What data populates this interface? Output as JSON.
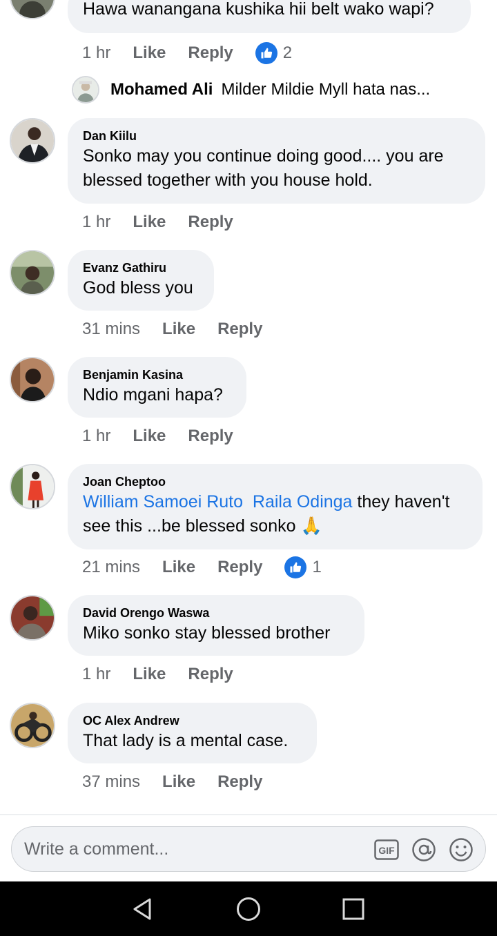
{
  "top_comment": {
    "text": "Hawa wanangana kushika hii belt wako wapi?",
    "time": "1 hr",
    "like_label": "Like",
    "reply_label": "Reply",
    "reaction_count": "2",
    "reply_preview": {
      "name": "Mohamed Ali",
      "snippet": "Milder Mildie Myll hata nas..."
    }
  },
  "comments": [
    {
      "author": "Dan Kiilu",
      "lines": [
        "Sonko may you  continue doing good.... you are",
        "blessed together with you house hold."
      ],
      "time": "1 hr",
      "like_label": "Like",
      "reply_label": "Reply"
    },
    {
      "author": "Evanz Gathiru",
      "lines": [
        "God bless you"
      ],
      "time": "31 mins",
      "like_label": "Like",
      "reply_label": "Reply"
    },
    {
      "author": "Benjamin Kasina",
      "lines": [
        "Ndio mgani hapa?"
      ],
      "time": "1 hr",
      "like_label": "Like",
      "reply_label": "Reply"
    },
    {
      "author": "Joan Cheptoo",
      "mention_1": "William Samoei Ruto",
      "mention_2": "Raila Odinga",
      "line1_rest": " they haven't",
      "line2": "see this ...be blessed sonko ",
      "emoji": "🙏",
      "time": "21 mins",
      "like_label": "Like",
      "reply_label": "Reply",
      "reaction_count": "1"
    },
    {
      "author": "David Orengo Waswa",
      "lines": [
        "Miko sonko stay blessed brother"
      ],
      "time": "1 hr",
      "like_label": "Like",
      "reply_label": "Reply"
    },
    {
      "author": "OC Alex Andrew",
      "lines": [
        "That lady is a mental case."
      ],
      "time": "37 mins",
      "like_label": "Like",
      "reply_label": "Reply"
    }
  ],
  "composer": {
    "placeholder": "Write a comment...",
    "gif_label": "GIF"
  },
  "colors": {
    "bubble": "#f0f2f5",
    "meta": "#65676b",
    "link": "#1b74e4",
    "like_badge": "#1b74e4"
  }
}
